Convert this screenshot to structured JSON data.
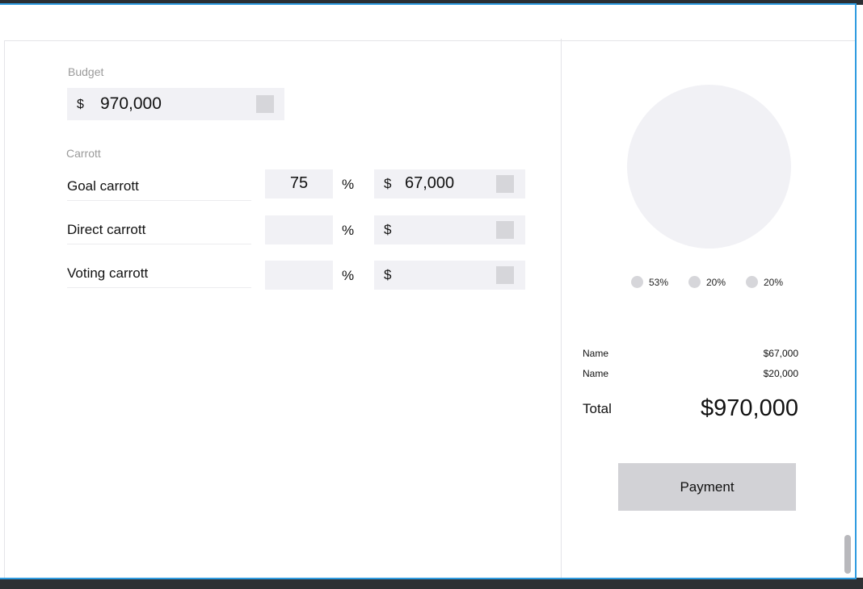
{
  "budget": {
    "label": "Budget",
    "currency": "$",
    "value": "970,000"
  },
  "carrott": {
    "label": "Carrott",
    "rows": [
      {
        "label": "Goal carrott",
        "percent": "75",
        "percent_sign": "%",
        "currency": "$",
        "amount": "67,000"
      },
      {
        "label": "Direct carrott",
        "percent": "",
        "percent_sign": "%",
        "currency": "$",
        "amount": ""
      },
      {
        "label": "Voting carrott",
        "percent": "",
        "percent_sign": "%",
        "currency": "$",
        "amount": ""
      }
    ]
  },
  "chart": {
    "legend": [
      "53%",
      "20%",
      "20%"
    ]
  },
  "summary": {
    "items": [
      {
        "name": "Name",
        "amount": "$67,000"
      },
      {
        "name": "Name",
        "amount": "$20,000"
      }
    ],
    "total_label": "Total",
    "total_value": "$970,000"
  },
  "actions": {
    "payment_label": "Payment"
  },
  "colors": {
    "accent": "#2e9be0",
    "field_bg": "#f1f1f5",
    "placeholder": "#d6d6da",
    "button_bg": "#d2d2d6"
  }
}
